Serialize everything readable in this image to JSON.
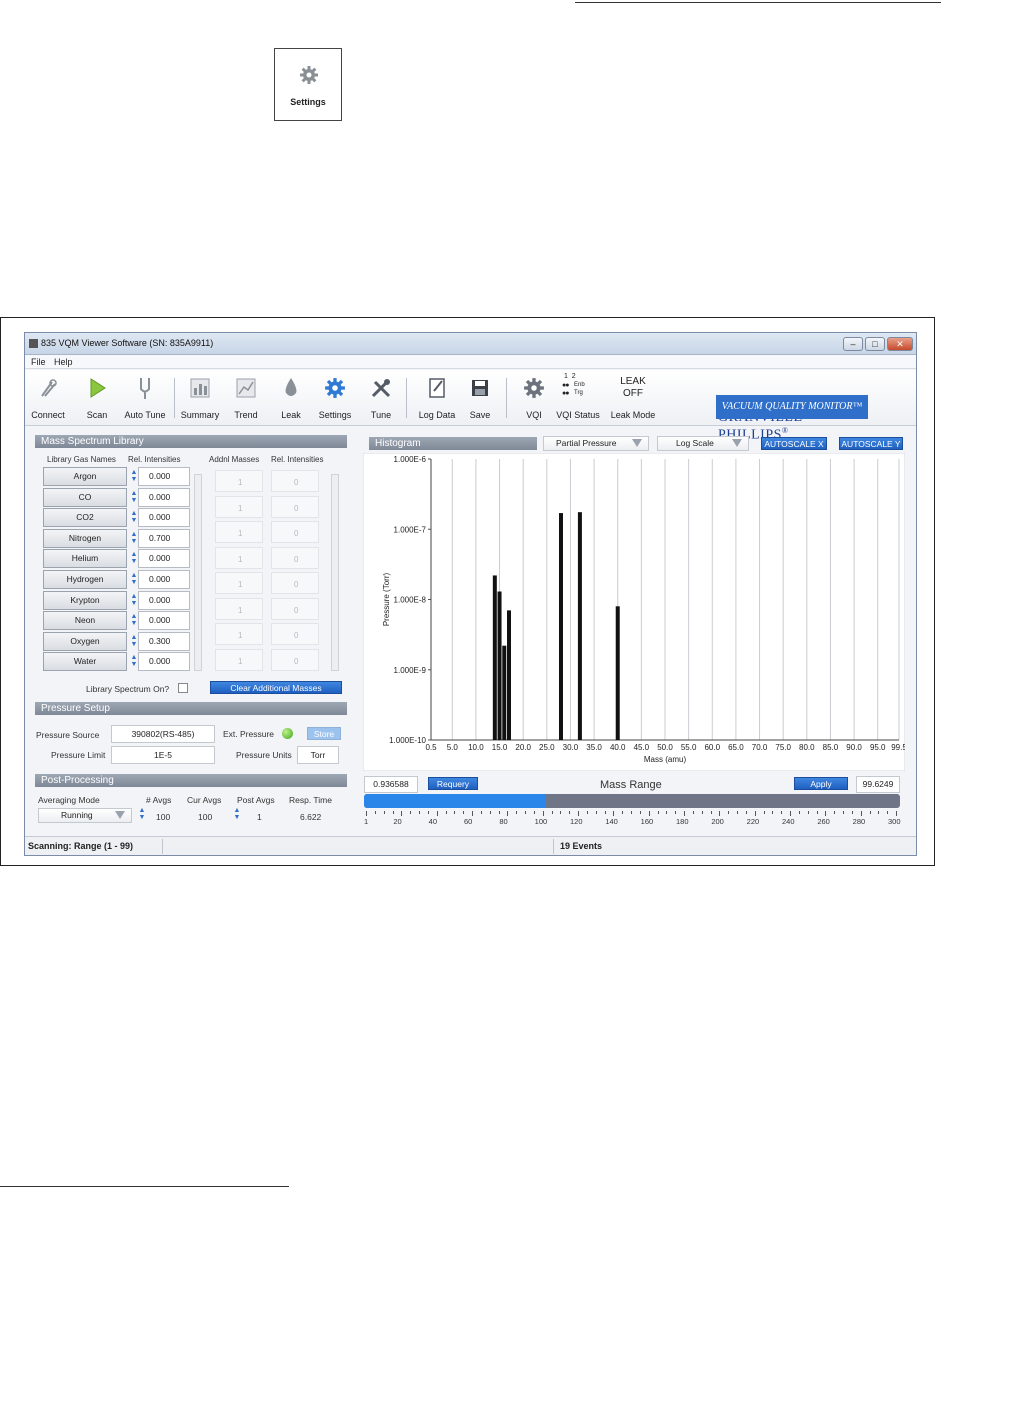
{
  "settings_icon": {
    "icon": "gear-icon",
    "label": "Settings"
  },
  "window": {
    "title": "835 VQM Viewer Software (SN: 835A9911)",
    "menu": [
      "File",
      "Help"
    ]
  },
  "toolbar": {
    "items": [
      {
        "label": "Connect",
        "icon": "plug-icon"
      },
      {
        "label": "Scan",
        "icon": "play-icon"
      },
      {
        "label": "Auto Tune",
        "icon": "tuning-fork-icon"
      },
      {
        "label": "Summary",
        "icon": "summary-chart-icon"
      },
      {
        "label": "Trend",
        "icon": "trend-chart-icon"
      },
      {
        "label": "Leak",
        "icon": "drop-icon"
      },
      {
        "label": "Settings",
        "icon": "gear-icon"
      },
      {
        "label": "Tune",
        "icon": "tools-icon"
      },
      {
        "label": "Log Data",
        "icon": "log-icon"
      },
      {
        "label": "Save",
        "icon": "save-icon"
      },
      {
        "label": "VQI",
        "icon": "gear-icon"
      },
      {
        "label": "VQI Status",
        "icon": "status-lights-icon"
      },
      {
        "label": "Leak Mode",
        "icon": "leak-mode-icon"
      }
    ],
    "vqi_status": {
      "nums": "1  2",
      "enb": "Enb",
      "trg": "Trg"
    },
    "leak_mode": {
      "line1": "LEAK",
      "line2": "OFF"
    }
  },
  "brand": {
    "name": "GRANVILLE-PHILLIPS",
    "reg": "®",
    "badge": "VACUUM QUALITY MONITOR™"
  },
  "library": {
    "title": "Mass Spectrum Library",
    "col_gas": "Library Gas Names",
    "col_rel": "Rel. Intensities",
    "col_addl": "Addnl Masses",
    "col_rel2": "Rel. Intensities",
    "gases": [
      {
        "name": "Argon",
        "value": "0.000"
      },
      {
        "name": "CO",
        "value": "0.000"
      },
      {
        "name": "CO2",
        "value": "0.000"
      },
      {
        "name": "Nitrogen",
        "value": "0.700"
      },
      {
        "name": "Helium",
        "value": "0.000"
      },
      {
        "name": "Hydrogen",
        "value": "0.000"
      },
      {
        "name": "Krypton",
        "value": "0.000"
      },
      {
        "name": "Neon",
        "value": "0.000"
      },
      {
        "name": "Oxygen",
        "value": "0.300"
      },
      {
        "name": "Water",
        "value": "0.000"
      }
    ],
    "addl": [
      {
        "mass": "1",
        "rel": "0"
      },
      {
        "mass": "1",
        "rel": "0"
      },
      {
        "mass": "1",
        "rel": "0"
      },
      {
        "mass": "1",
        "rel": "0"
      },
      {
        "mass": "1",
        "rel": "0"
      },
      {
        "mass": "1",
        "rel": "0"
      },
      {
        "mass": "1",
        "rel": "0"
      },
      {
        "mass": "1",
        "rel": "0"
      }
    ],
    "spectrum_on_label": "Library Spectrum On?",
    "clear_button": "Clear Additional Masses"
  },
  "pressure": {
    "title": "Pressure Setup",
    "source_label": "Pressure Source",
    "source_value": "390802(RS-485)",
    "ext_label": "Ext. Pressure",
    "store_button": "Store",
    "limit_label": "Pressure Limit",
    "limit_value": "1E-5",
    "units_label": "Pressure Units",
    "units_value": "Torr"
  },
  "post": {
    "title": "Post-Processing",
    "avg_mode_label": "Averaging Mode",
    "avg_mode_value": "Running",
    "avgs_label": "# Avgs",
    "avgs_value": "100",
    "cur_label": "Cur Avgs",
    "cur_value": "100",
    "post_label": "Post Avgs",
    "post_value": "1",
    "resp_label": "Resp. Time",
    "resp_value": "6.622"
  },
  "histogram": {
    "title": "Histogram",
    "mode": "Partial Pressure",
    "scale": "Log Scale",
    "autoscale_x": "AUTOSCALE X",
    "autoscale_y": "AUTOSCALE Y"
  },
  "chart_data": {
    "type": "bar",
    "xlabel": "Mass (amu)",
    "ylabel": "Pressure (Torr)",
    "ylog": true,
    "ylim": [
      1e-10,
      1e-06
    ],
    "yticks": [
      "1.000E-6",
      "1.000E-7",
      "1.000E-8",
      "1.000E-9",
      "1.000E-10"
    ],
    "xlim": [
      0.5,
      99.5
    ],
    "xticks": [
      "0.5",
      "5.0",
      "10.0",
      "15.0",
      "20.0",
      "25.0",
      "30.0",
      "35.0",
      "40.0",
      "45.0",
      "50.0",
      "55.0",
      "60.0",
      "65.0",
      "70.0",
      "75.0",
      "80.0",
      "85.0",
      "90.0",
      "95.0",
      "99.5"
    ],
    "points": [
      {
        "x": 14,
        "y": 2.2e-08
      },
      {
        "x": 15,
        "y": 1.3e-08
      },
      {
        "x": 16,
        "y": 2.2e-09
      },
      {
        "x": 17,
        "y": 7e-09
      },
      {
        "x": 28,
        "y": 1.7e-07
      },
      {
        "x": 32,
        "y": 1.75e-07
      },
      {
        "x": 40,
        "y": 8e-09
      }
    ],
    "grid": true
  },
  "mass_range": {
    "low": "0.936588",
    "requery": "Requery",
    "label": "Mass Range",
    "apply": "Apply",
    "high": "99.6249",
    "fill_fraction": 0.34,
    "ticks": [
      "1",
      "20",
      "40",
      "60",
      "80",
      "100",
      "120",
      "140",
      "160",
      "180",
      "200",
      "220",
      "240",
      "260",
      "280",
      "300"
    ]
  },
  "status": {
    "scanning": "Scanning: Range (1 - 99)",
    "events": "19 Events"
  }
}
